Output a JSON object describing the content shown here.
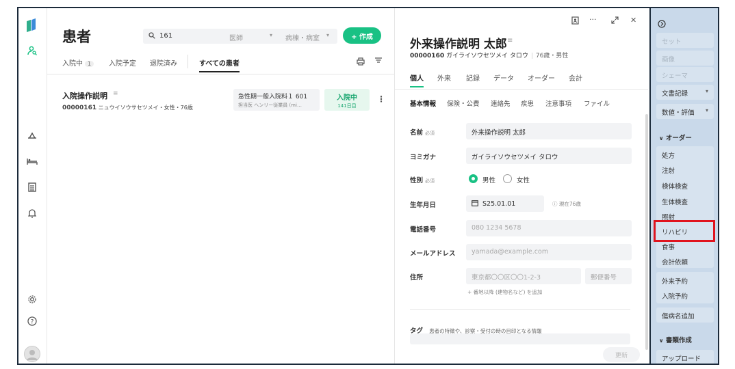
{
  "nav": {
    "icons": [
      "logo-icon",
      "patient-icon",
      "ward-icon",
      "bed-icon",
      "document-icon",
      "bell-icon",
      "gear-icon",
      "help-icon",
      "avatar"
    ]
  },
  "list": {
    "title": "患者",
    "search": {
      "value": "161",
      "doctor_placeholder": "医師",
      "ward_placeholder": "病棟・病室"
    },
    "create_label": "+ 作成",
    "tabs": [
      {
        "label": "入院中",
        "count": "1"
      },
      {
        "label": "入院予定"
      },
      {
        "label": "退院済み"
      },
      {
        "label": "すべての患者",
        "active": true
      }
    ],
    "patients": [
      {
        "name": "入院操作説明",
        "id": "00000161",
        "kana_sex_age": "ニュウイソウサセツメイ・女性・76歳",
        "ward": "急性期一般入院料１ 601",
        "doctor": "担当医 ヘンリー従業員 (mi…",
        "status": "入院中",
        "days": "141日目"
      }
    ]
  },
  "detail": {
    "name": "外来操作説明 太郎",
    "id": "00000160",
    "kana": "ガイライソウセツメイ タロウ",
    "age_sex": "76歳・男性",
    "tabs": [
      "個人",
      "外来",
      "記録",
      "データ",
      "オーダー",
      "会計"
    ],
    "subtabs": [
      "基本情報",
      "保険・公費",
      "連絡先",
      "疾患",
      "注意事項",
      "ファイル"
    ],
    "form": {
      "name_label": "名前",
      "required": "必須",
      "name_value": "外来操作説明 太郎",
      "kana_label": "ヨミガナ",
      "kana_value": "ガイライソウセツメイ タロウ",
      "sex_label": "性別",
      "male": "男性",
      "female": "女性",
      "birth_label": "生年月日",
      "birth_value": "S25.01.01",
      "age_note": "現在76歳",
      "phone_label": "電話番号",
      "phone_placeholder": "080 1234 5678",
      "email_label": "メールアドレス",
      "email_placeholder": "yamada@example.com",
      "address_label": "住所",
      "address_placeholder": "東京都〇〇区〇〇1-2-3",
      "zip_placeholder": "郵便番号",
      "address_add": "+ 番地以降 (建物名など) を追加",
      "tag_label": "タグ",
      "tag_desc": "患者の特徴や、診察・受付の時の目印となる情報"
    },
    "update_label": "更新"
  },
  "rpanel": {
    "set": "セット",
    "image": "画像",
    "schema": "シェーマ",
    "doc_record": "文書記録",
    "value_eval": "数値・評価",
    "order_section": "オーダー",
    "orders": [
      "処方",
      "注射",
      "検体検査",
      "生体検査",
      "照射",
      "リハビリ",
      "食事",
      "会計依頼"
    ],
    "outpatient": "外来予約",
    "inpatient": "入院予約",
    "add_disease": "傷病名追加",
    "doc_section": "書類作成",
    "upload": "アップロード"
  }
}
